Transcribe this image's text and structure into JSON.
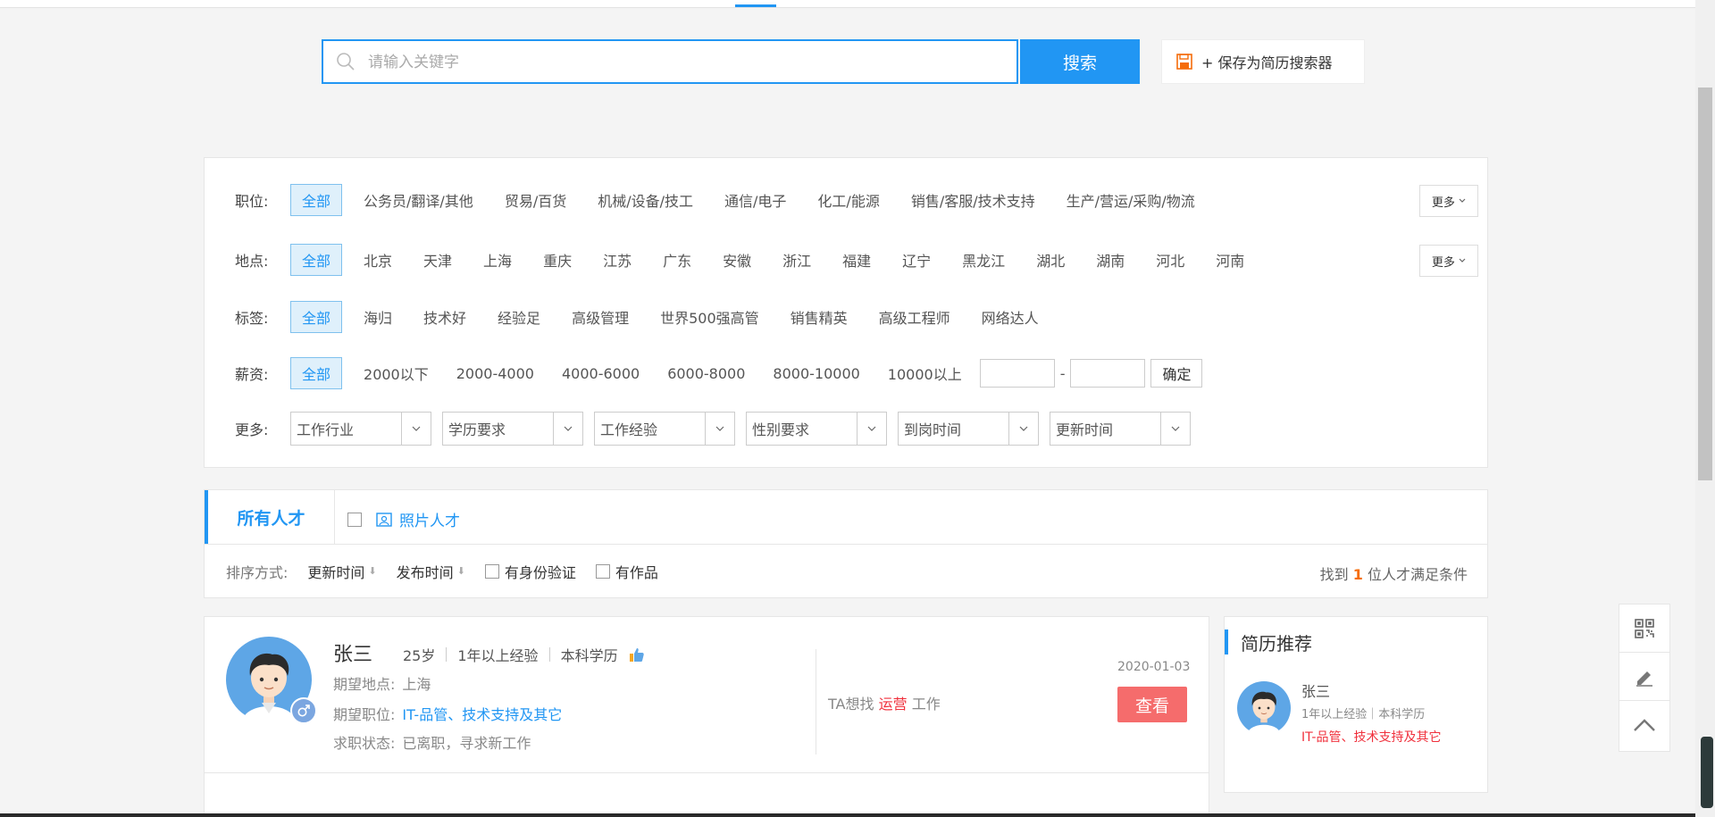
{
  "search": {
    "placeholder": "请输入关键字",
    "button_label": "搜索",
    "save_label": "+ 保存为简历搜索器"
  },
  "filters": {
    "position": {
      "label": "职位:",
      "items": [
        "全部",
        "公务员/翻译/其他",
        "贸易/百货",
        "机械/设备/技工",
        "通信/电子",
        "化工/能源",
        "销售/客服/技术支持",
        "生产/营运/采购/物流"
      ],
      "more": "更多"
    },
    "location": {
      "label": "地点:",
      "items": [
        "全部",
        "北京",
        "天津",
        "上海",
        "重庆",
        "江苏",
        "广东",
        "安徽",
        "浙江",
        "福建",
        "辽宁",
        "黑龙江",
        "湖北",
        "湖南",
        "河北",
        "河南"
      ],
      "more": "更多"
    },
    "tags": {
      "label": "标签:",
      "items": [
        "全部",
        "海归",
        "技术好",
        "经验足",
        "高级管理",
        "世界500强高管",
        "销售精英",
        "高级工程师",
        "网络达人"
      ]
    },
    "salary": {
      "label": "薪资:",
      "items": [
        "全部",
        "2000以下",
        "2000-4000",
        "4000-6000",
        "6000-8000",
        "8000-10000",
        "10000以上"
      ],
      "dash": "-",
      "confirm": "确定"
    },
    "more": {
      "label": "更多:",
      "selects": [
        "工作行业",
        "学历要求",
        "工作经验",
        "性别要求",
        "到岗时间",
        "更新时间"
      ]
    }
  },
  "tabs": {
    "all_label": "所有人才",
    "photo_label": "照片人才"
  },
  "sort": {
    "label": "排序方式:",
    "options": [
      "更新时间",
      "发布时间"
    ],
    "checks": [
      "有身份验证",
      "有作品"
    ],
    "found_prefix": "找到",
    "found_count": "1",
    "found_suffix": "位人才满足条件"
  },
  "result": {
    "name": "张三",
    "age": "25岁",
    "experience": "1年以上经验",
    "education": "本科学历",
    "location_label": "期望地点:",
    "location": "上海",
    "job_label": "期望职位:",
    "job": "IT-品管、技术支持及其它",
    "status_label": "求职状态:",
    "status": "已离职，寻求新工作",
    "want_prefix": "TA想找",
    "want_job": "运营",
    "want_suffix": "工作",
    "date": "2020-01-03",
    "view_label": "查看"
  },
  "recommend": {
    "title": "简历推荐",
    "name": "张三",
    "meta": "1年以上经验｜本科学历",
    "job": "IT-品管、技术支持及其它"
  },
  "colors": {
    "accent": "#2196f3",
    "danger": "#f56c6c",
    "highlight": "#f56c0a"
  },
  "icons": [
    "search-icon",
    "save-icon",
    "chevron-down-icon",
    "photo-icon",
    "thumbs-up-icon",
    "male-icon",
    "qrcode-icon",
    "edit-icon",
    "back-to-top-icon"
  ]
}
